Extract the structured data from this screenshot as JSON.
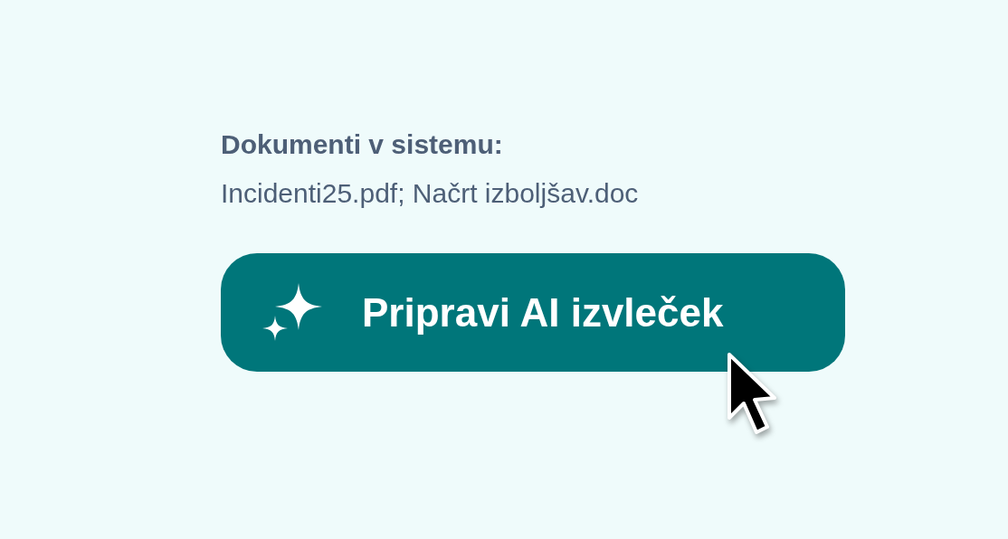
{
  "heading": "Dokumenti v sistemu:",
  "documents": "Incidenti25.pdf; Načrt izboljšav.doc",
  "button": {
    "label": "Pripravi AI izvleček"
  }
}
